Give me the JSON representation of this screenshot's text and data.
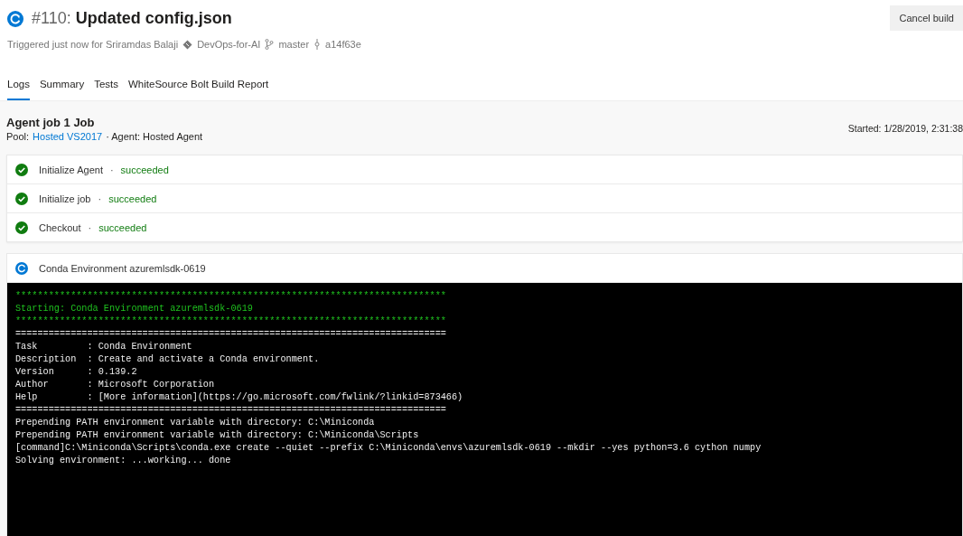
{
  "build": {
    "number": "#110:",
    "title": "Updated config.json",
    "running": true,
    "trigger": "Triggered just now for Sriramdas Balaji",
    "repo": "DevOps-for-AI",
    "branch": "master",
    "commit": "a14f63e",
    "cancel_button": "Cancel build"
  },
  "tabs": [
    {
      "label": "Logs",
      "selected": true
    },
    {
      "label": "Summary",
      "selected": false
    },
    {
      "label": "Tests",
      "selected": false
    },
    {
      "label": "WhiteSource Bolt Build Report",
      "selected": false
    }
  ],
  "job": {
    "title": "Agent job 1 Job",
    "pool_label": "Pool:",
    "pool": "Hosted VS2017",
    "agent": "· Agent: Hosted Agent",
    "started": "Started: 1/28/2019, 2:31:38"
  },
  "steps": [
    {
      "name": "Initialize Agent",
      "running": false,
      "separator": "·",
      "status": "succeeded"
    },
    {
      "name": "Initialize job",
      "running": false,
      "separator": "·",
      "status": "succeeded"
    },
    {
      "name": "Checkout",
      "running": false,
      "separator": "·",
      "status": "succeeded"
    }
  ],
  "active_step": {
    "name": "Conda Environment azuremlsdk-0619",
    "running": true
  },
  "log": [
    {
      "kind": "banner",
      "text": "******************************************************************************"
    },
    {
      "kind": "banner",
      "text": "Starting: Conda Environment azuremlsdk-0619"
    },
    {
      "kind": "banner",
      "text": "******************************************************************************"
    },
    {
      "kind": "plain",
      "text": "=============================================================================="
    },
    {
      "kind": "plain",
      "text": "Task         : Conda Environment"
    },
    {
      "kind": "plain",
      "text": "Description  : Create and activate a Conda environment."
    },
    {
      "kind": "plain",
      "text": "Version      : 0.139.2"
    },
    {
      "kind": "plain",
      "text": "Author       : Microsoft Corporation"
    },
    {
      "kind": "plain",
      "text": "Help         : [More information](https://go.microsoft.com/fwlink/?linkid=873466)"
    },
    {
      "kind": "plain",
      "text": "=============================================================================="
    },
    {
      "kind": "plain",
      "text": "Prepending PATH environment variable with directory: C:\\Miniconda"
    },
    {
      "kind": "plain",
      "text": "Prepending PATH environment variable with directory: C:\\Miniconda\\Scripts"
    },
    {
      "kind": "plain",
      "text": "[command]C:\\Miniconda\\Scripts\\conda.exe create --quiet --prefix C:\\Miniconda\\envs\\azuremlsdk-0619 --mkdir --yes python=3.6 cython numpy"
    },
    {
      "kind": "plain",
      "text": "Solving environment: ...working... done"
    }
  ]
}
